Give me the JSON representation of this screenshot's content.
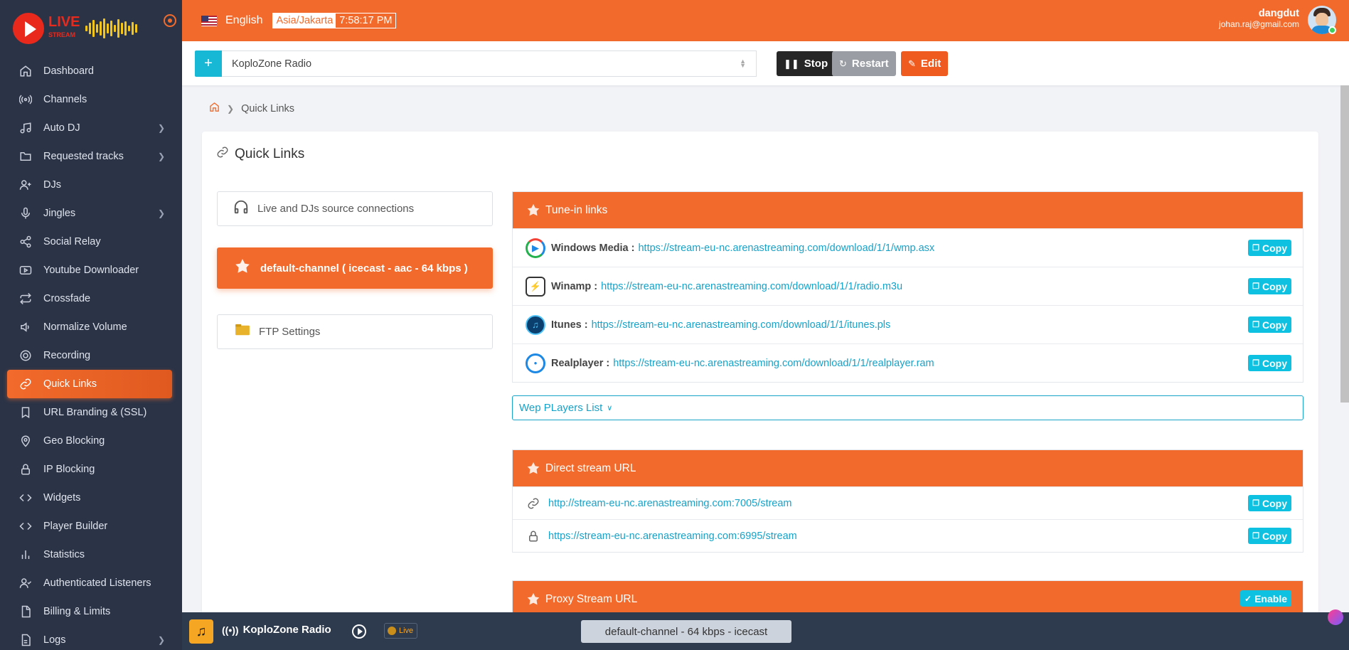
{
  "brand": {
    "logo_live": "LIVE",
    "logo_stream": "STREAM"
  },
  "header": {
    "language": "English",
    "timezone": "Asia/Jakarta",
    "time": "7:58:17 PM",
    "username": "dangdut",
    "email": "johan.raj@gmail.com"
  },
  "sidebar": {
    "items": [
      {
        "label": "Dashboard",
        "icon": "home-icon"
      },
      {
        "label": "Channels",
        "icon": "broadcast-icon"
      },
      {
        "label": "Auto DJ",
        "icon": "music-note-icon",
        "submenu": true
      },
      {
        "label": "Requested tracks",
        "icon": "folder-icon",
        "submenu": true
      },
      {
        "label": "DJs",
        "icon": "user-plus-icon"
      },
      {
        "label": "Jingles",
        "icon": "microphone-icon",
        "submenu": true
      },
      {
        "label": "Social Relay",
        "icon": "share-icon"
      },
      {
        "label": "Youtube Downloader",
        "icon": "youtube-icon"
      },
      {
        "label": "Crossfade",
        "icon": "crossfade-icon"
      },
      {
        "label": "Normalize Volume",
        "icon": "volume-icon"
      },
      {
        "label": "Recording",
        "icon": "record-icon"
      },
      {
        "label": "Quick Links",
        "icon": "link-icon",
        "active": true
      },
      {
        "label": "URL Branding & (SSL)",
        "icon": "bookmark-icon"
      },
      {
        "label": "Geo Blocking",
        "icon": "map-pin-icon"
      },
      {
        "label": "IP Blocking",
        "icon": "lock-icon"
      },
      {
        "label": "Widgets",
        "icon": "code-icon"
      },
      {
        "label": "Player Builder",
        "icon": "code-icon"
      },
      {
        "label": "Statistics",
        "icon": "bar-chart-icon"
      },
      {
        "label": "Authenticated Listeners",
        "icon": "user-check-icon"
      },
      {
        "label": "Billing & Limits",
        "icon": "file-icon"
      },
      {
        "label": "Logs",
        "icon": "file-text-icon",
        "submenu": true
      }
    ]
  },
  "channel_bar": {
    "selected_channel": "KoploZone Radio",
    "stop_label": "Stop",
    "restart_label": "Restart",
    "edit_label": "Edit"
  },
  "breadcrumb": {
    "current": "Quick Links"
  },
  "page": {
    "title": "Quick Links",
    "tabs": [
      {
        "label": "Live and DJs source connections"
      },
      {
        "label": "default-channel ( icecast - aac - 64 kbps )"
      },
      {
        "label": "FTP Settings"
      }
    ],
    "tunein": {
      "title": "Tune-in links",
      "rows": [
        {
          "label": "Windows Media :",
          "url": "https://stream-eu-nc.arenastreaming.com/download/1/1/wmp.asx"
        },
        {
          "label": "Winamp :",
          "url": "https://stream-eu-nc.arenastreaming.com/download/1/1/radio.m3u"
        },
        {
          "label": "Itunes :",
          "url": "https://stream-eu-nc.arenastreaming.com/download/1/1/itunes.pls"
        },
        {
          "label": "Realplayer :",
          "url": "https://stream-eu-nc.arenastreaming.com/download/1/1/realplayer.ram"
        }
      ],
      "copy_label": "Copy"
    },
    "web_players_label": "Wep PLayers List",
    "direct": {
      "title": "Direct stream URL",
      "rows": [
        {
          "url": "http://stream-eu-nc.arenastreaming.com:7005/stream"
        },
        {
          "url": "https://stream-eu-nc.arenastreaming.com:6995/stream"
        }
      ],
      "copy_label": "Copy"
    },
    "proxy": {
      "title": "Proxy Stream URL",
      "enable_label": "Enable"
    }
  },
  "player": {
    "station": "KoploZone Radio",
    "live_label": "Live",
    "channel_info": "default-channel - 64 kbps - icecast"
  },
  "colors": {
    "accent": "#f26b2c",
    "sidebar": "#2b3447",
    "copy": "#0fc1e0",
    "link": "#17a2c8"
  }
}
